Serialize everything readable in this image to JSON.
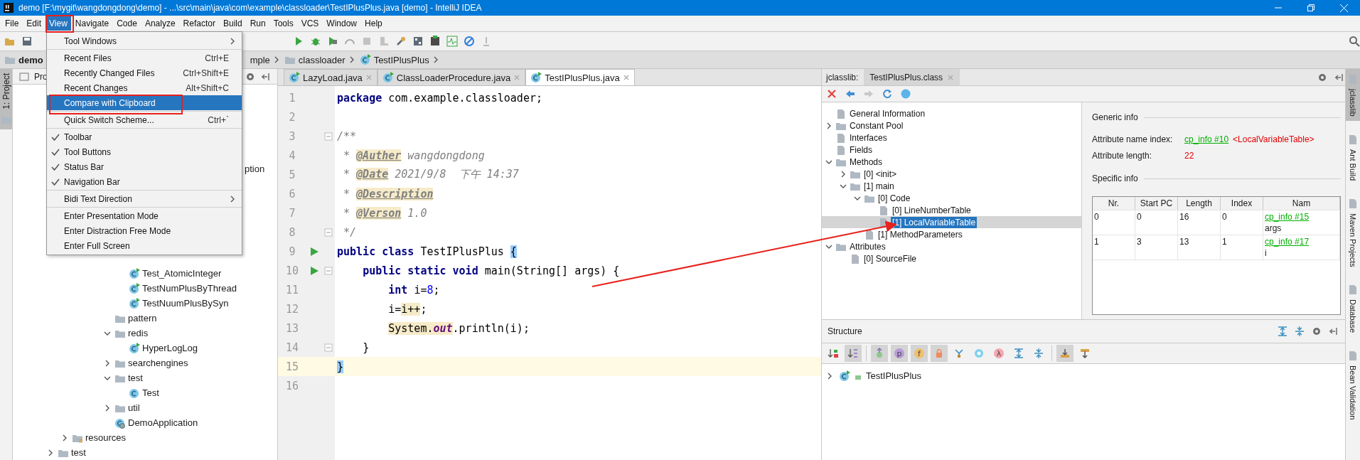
{
  "window": {
    "title": "demo [F:\\mygit\\wangdongdong\\demo] - ...\\src\\main\\java\\com\\example\\classloader\\TestIPlusPlus.java [demo] - IntelliJ IDEA"
  },
  "menu_bar": [
    {
      "label": "File",
      "selected": false
    },
    {
      "label": "Edit",
      "selected": false
    },
    {
      "label": "View",
      "selected": true
    },
    {
      "label": "Navigate",
      "selected": false
    },
    {
      "label": "Code",
      "selected": false
    },
    {
      "label": "Analyze",
      "selected": false
    },
    {
      "label": "Refactor",
      "selected": false
    },
    {
      "label": "Build",
      "selected": false
    },
    {
      "label": "Run",
      "selected": false
    },
    {
      "label": "Tools",
      "selected": false
    },
    {
      "label": "VCS",
      "selected": false
    },
    {
      "label": "Window",
      "selected": false
    },
    {
      "label": "Help",
      "selected": false
    }
  ],
  "view_menu": [
    {
      "kind": "item",
      "label": "Tool Windows",
      "submenu": true,
      "checked": false,
      "selected": false
    },
    {
      "kind": "separator"
    },
    {
      "kind": "item",
      "label": "Recent Files",
      "shortcut": "Ctrl+E",
      "submenu": false,
      "checked": false,
      "selected": false
    },
    {
      "kind": "item",
      "label": "Recently Changed Files",
      "shortcut": "Ctrl+Shift+E",
      "submenu": false,
      "checked": false,
      "selected": false
    },
    {
      "kind": "item",
      "label": "Recent Changes",
      "shortcut": "Alt+Shift+C",
      "submenu": false,
      "checked": false,
      "selected": false
    },
    {
      "kind": "item",
      "label": "Compare with Clipboard",
      "submenu": false,
      "checked": false,
      "selected": true
    },
    {
      "kind": "separator"
    },
    {
      "kind": "item",
      "label": "Quick Switch Scheme...",
      "shortcut": "Ctrl+`",
      "submenu": false,
      "checked": false,
      "selected": false
    },
    {
      "kind": "separator"
    },
    {
      "kind": "item",
      "label": "Toolbar",
      "submenu": false,
      "checked": true,
      "selected": false
    },
    {
      "kind": "item",
      "label": "Tool Buttons",
      "submenu": false,
      "checked": true,
      "selected": false
    },
    {
      "kind": "item",
      "label": "Status Bar",
      "submenu": false,
      "checked": true,
      "selected": false
    },
    {
      "kind": "item",
      "label": "Navigation Bar",
      "submenu": false,
      "checked": true,
      "selected": false
    },
    {
      "kind": "separator"
    },
    {
      "kind": "item",
      "label": "Bidi Text Direction",
      "submenu": true,
      "checked": false,
      "selected": false
    },
    {
      "kind": "separator"
    },
    {
      "kind": "item",
      "label": "Enter Presentation Mode",
      "submenu": false,
      "checked": false,
      "selected": false
    },
    {
      "kind": "item",
      "label": "Enter Distraction Free Mode",
      "submenu": false,
      "checked": false,
      "selected": false
    },
    {
      "kind": "item",
      "label": "Enter Full Screen",
      "submenu": false,
      "checked": false,
      "selected": false
    }
  ],
  "navigation_bar": {
    "root": "demo",
    "fragment": "mple",
    "items": [
      {
        "label": "classloader",
        "kind": "folder"
      },
      {
        "label": "TestIPlusPlus",
        "kind": "class"
      }
    ]
  },
  "left_strip": [
    {
      "label": "1: Project",
      "selected": true
    }
  ],
  "project_panel": {
    "title": "Pro",
    "fragment": "ption",
    "tree": [
      {
        "children": [
          {
            "children": [
              {
                "children": [
                  {
                    "children": [
                      {
                        "children": [
                          {
                            "label": "Test_AtomicInteger",
                            "kind": "runclass"
                          },
                          {
                            "label": "TestNumPlusByThread",
                            "kind": "runclass"
                          },
                          {
                            "label": "TestNuumPlusBySyn",
                            "kind": "runclass"
                          }
                        ]
                      },
                      {
                        "label": "pattern",
                        "kind": "package"
                      },
                      {
                        "label": "redis",
                        "kind": "package",
                        "expanded": true,
                        "children": [
                          {
                            "label": "HyperLogLog",
                            "kind": "runclass"
                          }
                        ]
                      },
                      {
                        "label": "searchengines",
                        "kind": "package",
                        "expanded": false
                      },
                      {
                        "label": "test",
                        "kind": "package",
                        "expanded": true,
                        "children": [
                          {
                            "label": "Test",
                            "kind": "class"
                          }
                        ]
                      },
                      {
                        "label": "util",
                        "kind": "package",
                        "expanded": false
                      },
                      {
                        "label": "DemoApplication",
                        "kind": "app"
                      }
                    ]
                  }
                ]
              }
            ]
          },
          {
            "label": "resources",
            "kind": "resources",
            "expanded": false
          }
        ]
      },
      {
        "label": "test",
        "kind": "folder",
        "expanded": false
      }
    ]
  },
  "editor": {
    "tabs": [
      {
        "label": "LazyLoad.java",
        "selected": false
      },
      {
        "label": "ClassLoaderProcedure.java",
        "selected": false
      },
      {
        "label": "TestIPlusPlus.java",
        "selected": true
      }
    ],
    "lines": [
      {
        "number": "1",
        "run": false,
        "fold": false,
        "current": false,
        "tokens": [
          {
            "kind": "keyword",
            "text": "package"
          },
          {
            "kind": "plain",
            "text": " com.example.classloader;"
          }
        ]
      },
      {
        "number": "2",
        "run": false,
        "fold": false,
        "current": false
      },
      {
        "number": "3",
        "run": false,
        "fold": true,
        "current": false,
        "tokens": [
          {
            "kind": "comment",
            "text": "/**"
          }
        ]
      },
      {
        "number": "4",
        "run": false,
        "fold": false,
        "current": false,
        "tokens": [
          {
            "kind": "comment",
            "text": " * "
          },
          {
            "kind": "tag",
            "text": "@Auther"
          },
          {
            "kind": "comment",
            "text": " wangdongdong"
          }
        ]
      },
      {
        "number": "5",
        "run": false,
        "fold": false,
        "current": false,
        "tokens": [
          {
            "kind": "comment",
            "text": " * "
          },
          {
            "kind": "tag",
            "text": "@Date"
          },
          {
            "kind": "comment",
            "text": " 2021/9/8  下午 14:37"
          }
        ]
      },
      {
        "number": "6",
        "run": false,
        "fold": false,
        "current": false,
        "tokens": [
          {
            "kind": "comment",
            "text": " * "
          },
          {
            "kind": "tag",
            "text": "@Description"
          }
        ]
      },
      {
        "number": "7",
        "run": false,
        "fold": false,
        "current": false,
        "tokens": [
          {
            "kind": "comment",
            "text": " * "
          },
          {
            "kind": "tag",
            "text": "@Verson"
          },
          {
            "kind": "comment",
            "text": " 1.0"
          }
        ]
      },
      {
        "number": "8",
        "run": false,
        "fold": true,
        "current": false,
        "tokens": [
          {
            "kind": "comment",
            "text": " */"
          }
        ]
      },
      {
        "number": "9",
        "run": true,
        "fold": false,
        "current": false,
        "tokens": [
          {
            "kind": "keyword",
            "text": "public class "
          },
          {
            "kind": "plain",
            "text": "TestIPlusPlus "
          },
          {
            "kind": "brace",
            "text": "{"
          }
        ]
      },
      {
        "number": "10",
        "run": true,
        "fold": true,
        "current": false,
        "tokens": [
          {
            "kind": "keyword",
            "text": "    public static void "
          },
          {
            "kind": "plain",
            "text": "main(String[] args) {"
          }
        ]
      },
      {
        "number": "11",
        "run": false,
        "fold": false,
        "current": false,
        "tokens": [
          {
            "kind": "keyword",
            "text": "        int "
          },
          {
            "kind": "plain",
            "text": "i="
          },
          {
            "kind": "number",
            "text": "8"
          },
          {
            "kind": "plain",
            "text": ";"
          }
        ]
      },
      {
        "number": "12",
        "run": false,
        "fold": false,
        "current": false,
        "tokens": [
          {
            "kind": "plain",
            "text": "        i="
          },
          {
            "kind": "mark",
            "text": "i++"
          },
          {
            "kind": "plain",
            "text": ";"
          }
        ]
      },
      {
        "number": "13",
        "run": false,
        "fold": false,
        "current": false,
        "tokens": [
          {
            "kind": "mark",
            "text": "        System."
          },
          {
            "kind": "field",
            "text": "out"
          },
          {
            "kind": "plain",
            "text": ".println(i);"
          }
        ]
      },
      {
        "number": "14",
        "run": false,
        "fold": true,
        "current": false,
        "tokens": [
          {
            "kind": "plain",
            "text": "    }"
          }
        ]
      },
      {
        "number": "15",
        "run": false,
        "fold": false,
        "current": true,
        "tokens": [
          {
            "kind": "brace",
            "text": "}"
          }
        ]
      },
      {
        "number": "16",
        "run": false,
        "fold": false,
        "current": false
      }
    ]
  },
  "jclasslib": {
    "label": "jclasslib:",
    "tabs": [
      {
        "label": "TestIPlusPlus.class",
        "selected": true
      }
    ],
    "toolbar": [
      {
        "kind": "close",
        "disabled": false
      },
      {
        "kind": "back",
        "disabled": false
      },
      {
        "kind": "forward",
        "disabled": true
      },
      {
        "kind": "refresh",
        "disabled": false
      },
      {
        "kind": "web",
        "disabled": false
      }
    ],
    "tree": [
      {
        "label": "General Information",
        "selected": false
      },
      {
        "label": "Constant Pool",
        "expanded": false,
        "selected": false
      },
      {
        "label": "Interfaces",
        "selected": false
      },
      {
        "label": "Fields",
        "selected": false
      },
      {
        "label": "Methods",
        "expanded": true,
        "selected": false,
        "children": [
          {
            "label": "[0] <init>",
            "expanded": false,
            "selected": false
          },
          {
            "label": "[1] main",
            "expanded": true,
            "selected": false,
            "children": [
              {
                "label": "[0] Code",
                "expanded": true,
                "selected": false,
                "children": [
                  {
                    "label": "[0] LineNumberTable",
                    "selected": false
                  },
                  {
                    "label": "[1] LocalVariableTable",
                    "selected": true
                  }
                ]
              },
              {
                "label": "[1] MethodParameters",
                "selected": false
              }
            ]
          }
        ]
      },
      {
        "label": "Attributes",
        "expanded": true,
        "selected": false,
        "children": [
          {
            "label": "[0] SourceFile",
            "selected": false
          }
        ]
      }
    ],
    "generic_info": {
      "title": "Generic info",
      "rows": [
        {
          "label": "Attribute name index:",
          "link": "cp_info #10",
          "value": "<LocalVariableTable>"
        },
        {
          "label": "Attribute length:",
          "value": "22"
        }
      ]
    },
    "specific_info": {
      "title": "Specific info",
      "columns": [
        "Nr.",
        "Start PC",
        "Length",
        "Index",
        "Nam"
      ],
      "rows": [
        {
          "cells": [
            "0",
            "0",
            "16",
            "0"
          ],
          "link": "cp_info #15",
          "name": "args"
        },
        {
          "cells": [
            "1",
            "3",
            "13",
            "1"
          ],
          "link": "cp_info #17",
          "name": "i"
        }
      ]
    }
  },
  "structure": {
    "title": "Structure",
    "toolbar": [
      {
        "kind": "sort-visibility",
        "selected": false
      },
      {
        "kind": "sort-alpha",
        "selected": true
      },
      {
        "kind": "separator"
      },
      {
        "kind": "inherited",
        "selected": true
      },
      {
        "kind": "badge",
        "glyph": "p",
        "color": "#b99bd8",
        "selected": true
      },
      {
        "kind": "badge",
        "glyph": "f",
        "color": "#f0bf6b",
        "selected": true
      },
      {
        "kind": "lock",
        "selected": true
      },
      {
        "kind": "branch",
        "selected": false
      },
      {
        "kind": "ring",
        "selected": false
      },
      {
        "kind": "badge",
        "glyph": "λ",
        "color": "#f4a7b0",
        "selected": false
      },
      {
        "kind": "expand",
        "selected": false
      },
      {
        "kind": "collapse",
        "selected": false
      },
      {
        "kind": "separator"
      },
      {
        "kind": "scroll-to",
        "selected": true
      },
      {
        "kind": "scroll-from",
        "selected": false
      }
    ],
    "tree": [
      {
        "label": "TestIPlusPlus",
        "expanded": false
      }
    ]
  },
  "right_strip": [
    {
      "label": "jclasslib",
      "selected": true
    },
    {
      "label": "Ant Build",
      "selected": false
    },
    {
      "label": "Maven Projects",
      "selected": false
    },
    {
      "label": "Database",
      "selected": false
    },
    {
      "label": "Bean Validation",
      "selected": false
    }
  ]
}
